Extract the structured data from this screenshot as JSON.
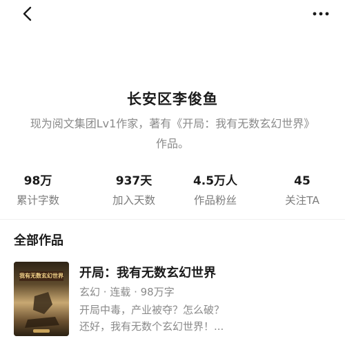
{
  "header": {
    "back_icon": "chevron-left-icon",
    "more_icon": "more-horizontal-icon"
  },
  "author": {
    "name": "长安区李俊鱼",
    "bio": "现为阅文集团Lv1作家，著有《开局：我有无数玄幻世界》作品。"
  },
  "stats": [
    {
      "value": "98万",
      "label": "累计字数"
    },
    {
      "value": "937天",
      "label": "加入天数"
    },
    {
      "value": "4.5万人",
      "label": "作品粉丝"
    },
    {
      "value": "45",
      "label": "关注TA"
    }
  ],
  "works": {
    "section_title": "全部作品",
    "items": [
      {
        "title": "开局：我有无数玄幻世界",
        "meta": "玄幻 · 连载 · 98万字",
        "description_line1": "开局中毒，产业被夺？怎么破？",
        "description_line2": "还好，我有无数个玄幻世界！...",
        "cover_text": "我有无数玄幻世界"
      }
    ]
  },
  "colors": {
    "text_primary": "#1a1a1a",
    "text_secondary": "#8a8a8a",
    "background": "#ffffff"
  }
}
